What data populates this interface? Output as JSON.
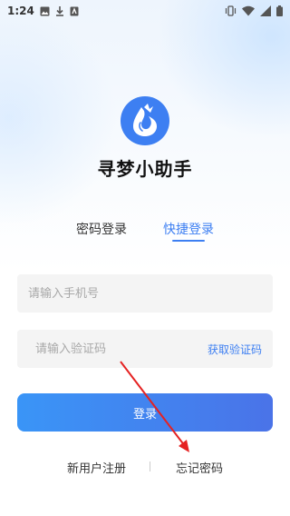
{
  "status_bar": {
    "time": "1:24",
    "left_icons": [
      "image-icon",
      "download-icon",
      "contacts-card-icon"
    ],
    "right_icons": [
      "vibrate-icon",
      "wifi-icon",
      "signal-icon",
      "battery-icon"
    ]
  },
  "app": {
    "name": "寻梦小助手",
    "logo": "water-drop-logo-icon",
    "brand_color": "#3d7ff2"
  },
  "tabs": [
    {
      "label": "密码登录",
      "active": false
    },
    {
      "label": "快捷登录",
      "active": true
    }
  ],
  "form": {
    "phone_placeholder": "请输入手机号",
    "code_placeholder": "请输入验证码",
    "get_code_label": "获取验证码",
    "login_label": "登录"
  },
  "footer": {
    "register_label": "新用户注册",
    "forgot_label": "忘记密码"
  },
  "annotation": {
    "type": "red-arrow",
    "color": "#e52222"
  }
}
